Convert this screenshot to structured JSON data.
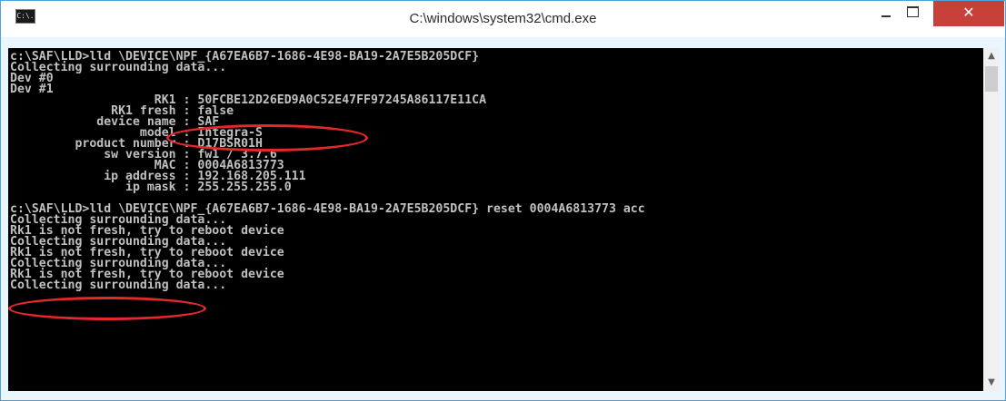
{
  "window": {
    "title": "C:\\windows\\system32\\cmd.exe",
    "icon_text": "C:\\.",
    "close_glyph": "✕",
    "up_arrow": "▲",
    "down_arrow": "▼"
  },
  "console": {
    "lines": [
      "c:\\SAF\\LLD>lld \\DEVICE\\NPF_{A67EA6B7-1686-4E98-BA19-2A7E5B205DCF}",
      "Collecting surrounding data...",
      "Dev #0",
      "Dev #1",
      "                    RK1 : 50FCBE12D26ED9A0C52E47FF97245A86117E11CA",
      "              RK1 fresh : false",
      "            device name : SAF",
      "                  model : Integra-S",
      "         product number : D17BSR01H",
      "             sw version : fw1 / 3.7.6",
      "                    MAC : 0004A6813773",
      "             ip address : 192.168.205.111",
      "                ip mask : 255.255.255.0",
      "",
      "c:\\SAF\\LLD>lld \\DEVICE\\NPF_{A67EA6B7-1686-4E98-BA19-2A7E5B205DCF} reset 0004A6813773 acc",
      "Collecting surrounding data...",
      "Rk1 is not fresh, try to reboot device",
      "Collecting surrounding data...",
      "Rk1 is not fresh, try to reboot device",
      "Collecting surrounding data...",
      "Rk1 is not fresh, try to reboot device",
      "Collecting surrounding data..."
    ]
  },
  "colors": {
    "console_background": "#000000",
    "console_text": "#c0c0c0",
    "close_button": "#c7403a",
    "annotation": "#e5282a",
    "window_border": "#4fa3dd"
  }
}
